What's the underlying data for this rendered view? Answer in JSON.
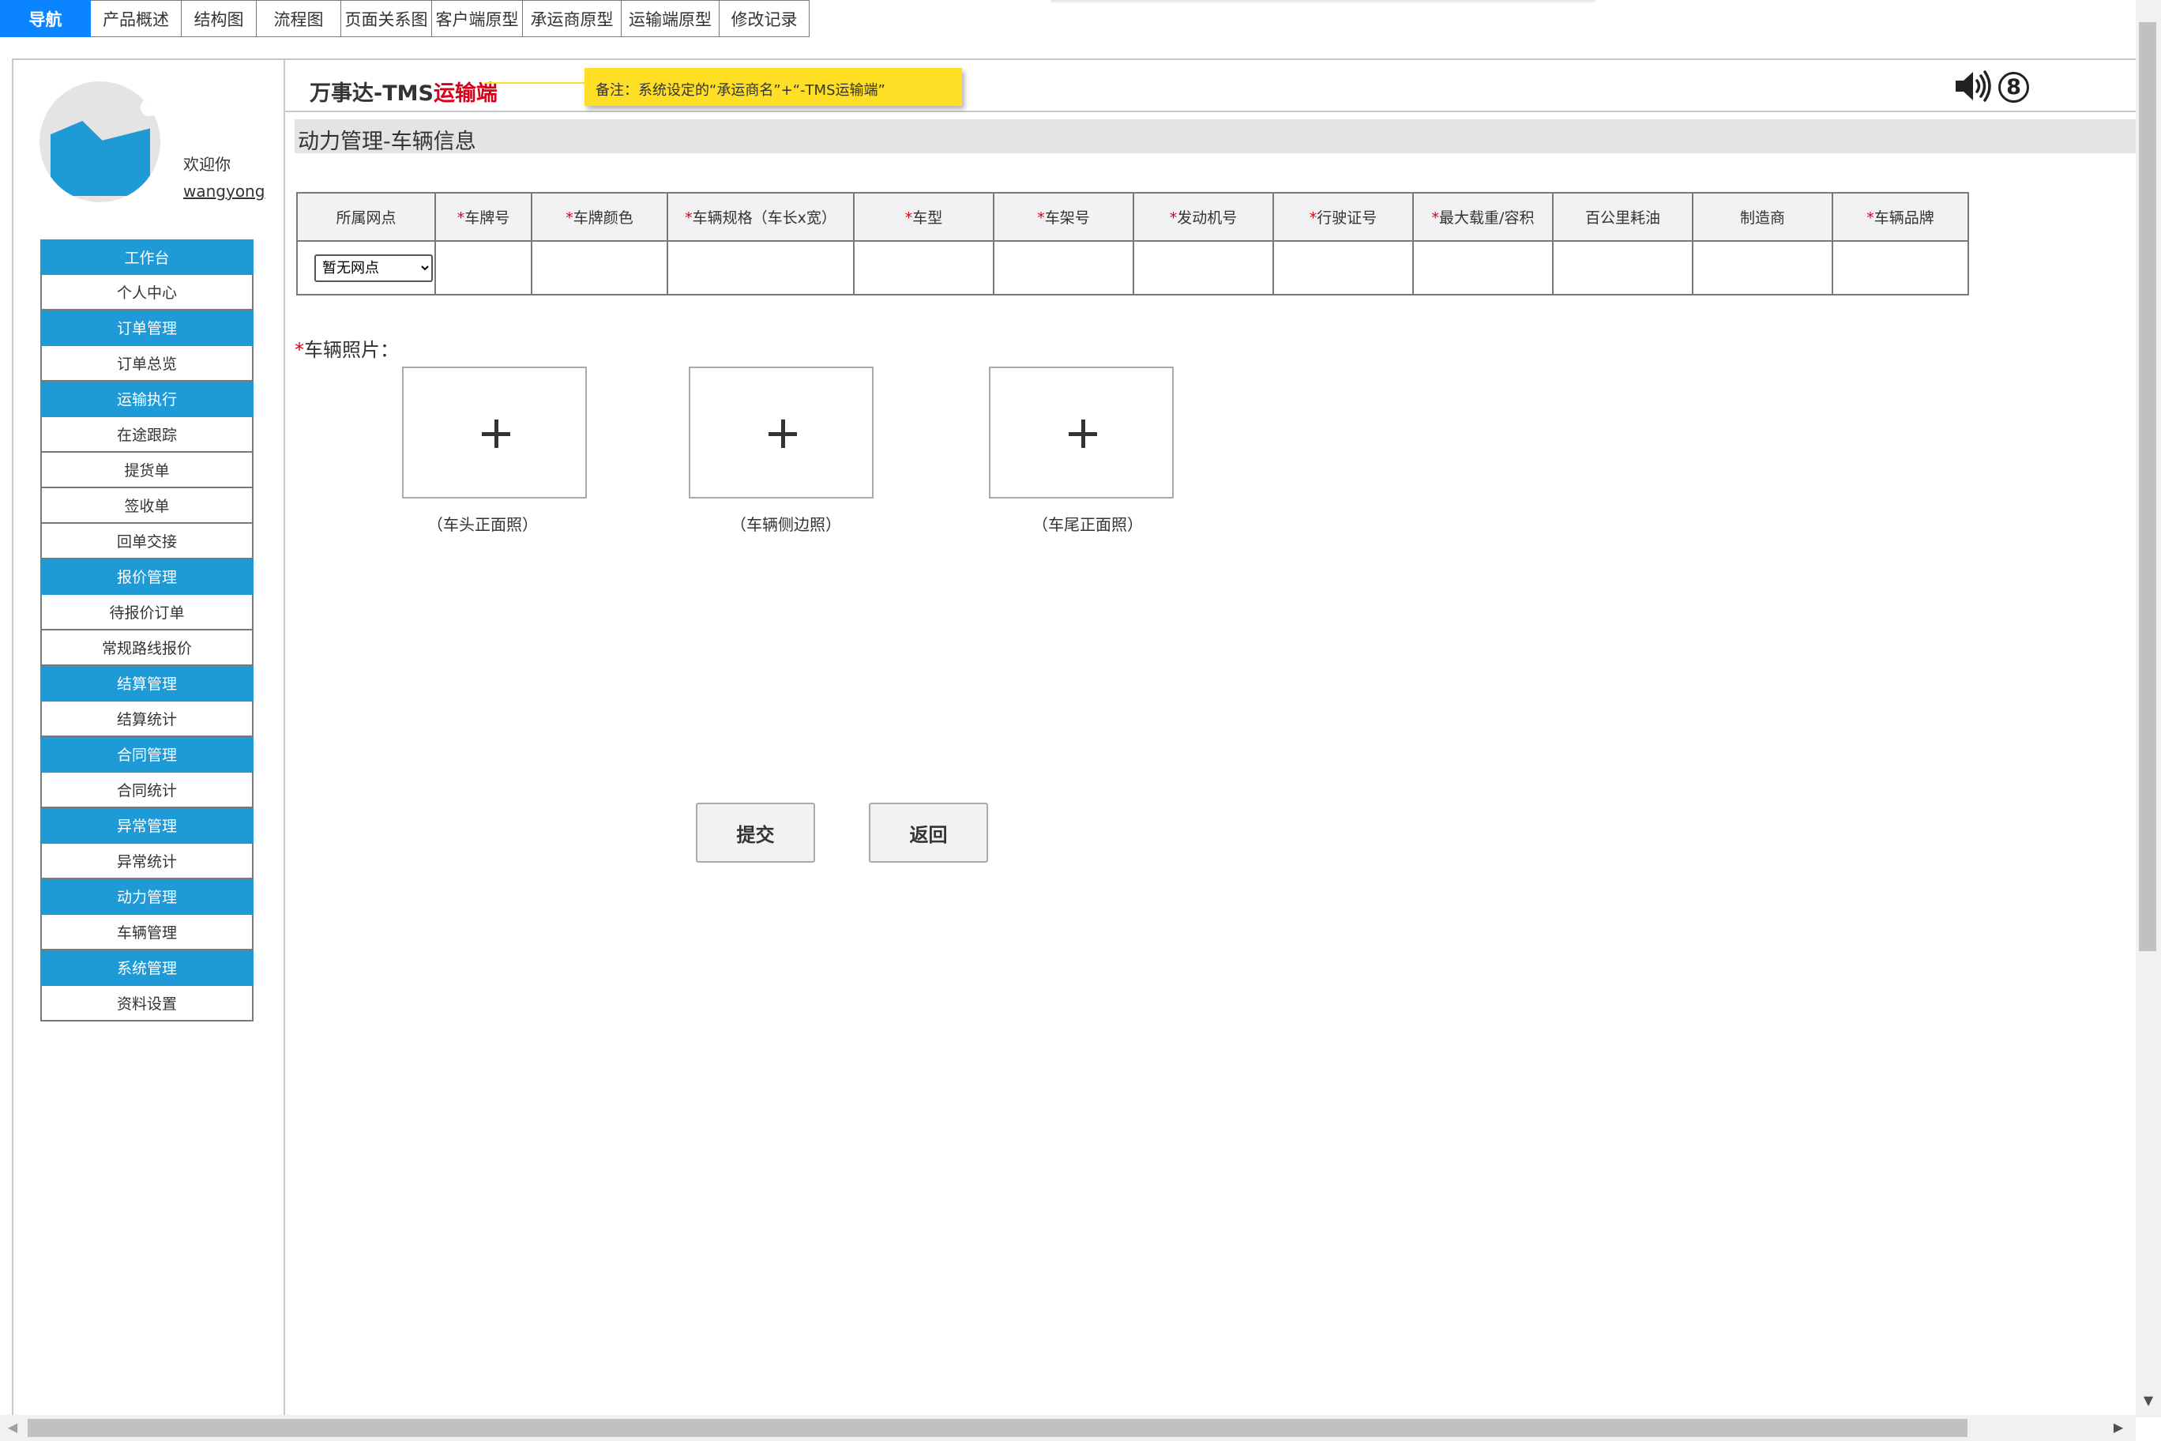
{
  "nav": {
    "tabs": [
      {
        "label": "导航"
      },
      {
        "label": "产品概述"
      },
      {
        "label": "结构图"
      },
      {
        "label": "流程图"
      },
      {
        "label": "页面关系图"
      },
      {
        "label": "客户端原型"
      },
      {
        "label": "承运商原型"
      },
      {
        "label": "运输端原型"
      },
      {
        "label": "修改记录"
      }
    ],
    "active_index": 0
  },
  "user": {
    "welcome": "欢迎你",
    "name": "wangyong"
  },
  "sidebar": {
    "items": [
      {
        "label": "工作台",
        "group": true
      },
      {
        "label": "个人中心",
        "group": false
      },
      {
        "label": "订单管理",
        "group": true
      },
      {
        "label": "订单总览",
        "group": false
      },
      {
        "label": "运输执行",
        "group": true
      },
      {
        "label": "在途跟踪",
        "group": false
      },
      {
        "label": "提货单",
        "group": false
      },
      {
        "label": "签收单",
        "group": false
      },
      {
        "label": "回单交接",
        "group": false
      },
      {
        "label": "报价管理",
        "group": true
      },
      {
        "label": "待报价订单",
        "group": false
      },
      {
        "label": "常规路线报价",
        "group": false
      },
      {
        "label": "结算管理",
        "group": true
      },
      {
        "label": "结算统计",
        "group": false
      },
      {
        "label": "合同管理",
        "group": true
      },
      {
        "label": "合同统计",
        "group": false
      },
      {
        "label": "异常管理",
        "group": true
      },
      {
        "label": "异常统计",
        "group": false
      },
      {
        "label": "动力管理",
        "group": true
      },
      {
        "label": "车辆管理",
        "group": false
      },
      {
        "label": "系统管理",
        "group": true
      },
      {
        "label": "资料设置",
        "group": false
      }
    ]
  },
  "header": {
    "title_prefix": "万事达-TMS",
    "title_accent": "运输端",
    "note": "备注：系统设定的“承运商名”+“-TMS运输端”",
    "badge": "8",
    "speaker_icon": "speaker-icon"
  },
  "page": {
    "title": "动力管理-车辆信息"
  },
  "table": {
    "required_mark": "*",
    "columns": [
      {
        "label": "所属网点",
        "required": false
      },
      {
        "label": "车牌号",
        "required": true
      },
      {
        "label": "车牌颜色",
        "required": true
      },
      {
        "label": "车辆规格（车长x宽）",
        "required": true
      },
      {
        "label": "车型",
        "required": true
      },
      {
        "label": "车架号",
        "required": true
      },
      {
        "label": "发动机号",
        "required": true
      },
      {
        "label": "行驶证号",
        "required": true
      },
      {
        "label": "最大载重/容积",
        "required": true
      },
      {
        "label": "百公里耗油",
        "required": false
      },
      {
        "label": "制造商",
        "required": false
      },
      {
        "label": "车辆品牌",
        "required": true
      }
    ],
    "site_select": {
      "value": "暂无网点",
      "options": [
        "暂无网点"
      ]
    }
  },
  "photos": {
    "label": "车辆照片：",
    "required_mark": "*",
    "slots": [
      {
        "caption": "（车头正面照）"
      },
      {
        "caption": "（车辆侧边照）"
      },
      {
        "caption": "（车尾正面照）"
      }
    ]
  },
  "actions": {
    "submit": "提交",
    "back": "返回"
  },
  "scrollbars": {
    "up_icon": "arrow-up-icon",
    "down_icon": "arrow-down-icon",
    "left_icon": "arrow-left-icon",
    "right_icon": "arrow-right-icon"
  }
}
